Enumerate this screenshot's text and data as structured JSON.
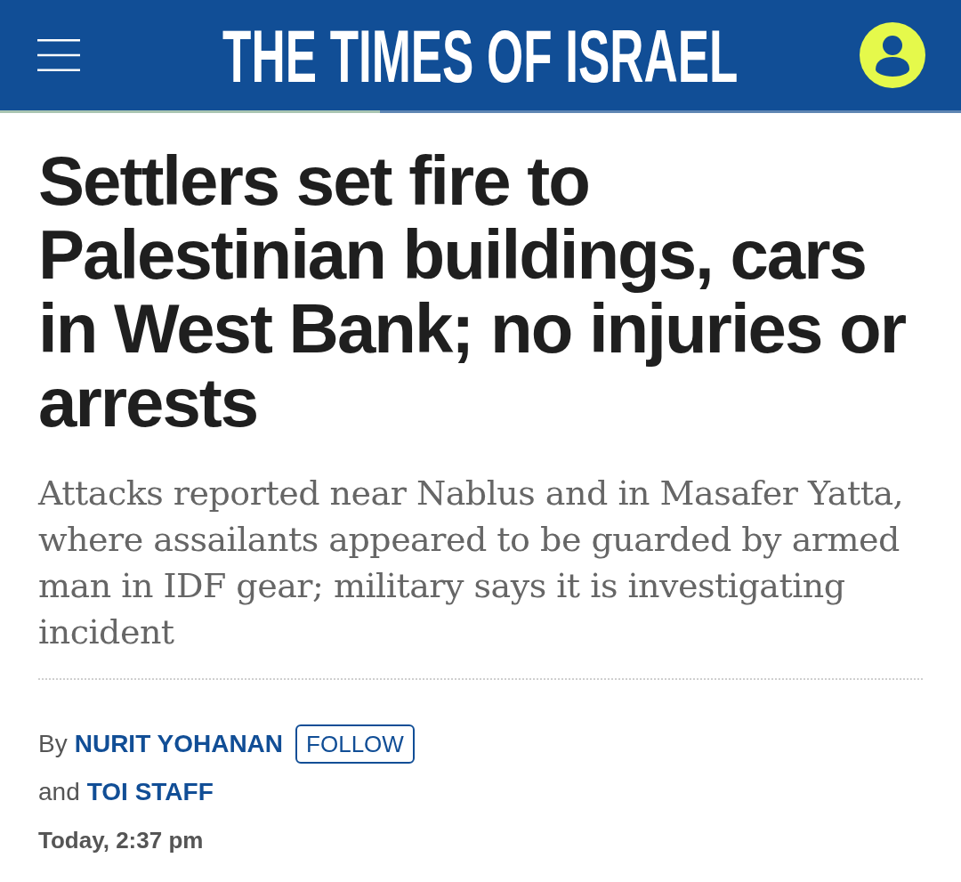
{
  "header": {
    "logo": "THE TIMES OF ISRAEL"
  },
  "reading_progress": {
    "level": 0.395
  },
  "article": {
    "headline": "Settlers set fire to Palestinian buildings, cars in West Bank; no injuries or arrests",
    "subheadline": "Attacks reported near Nablus and in Masafer Yatta, where assailants appeared to be guarded by armed man in IDF gear; military says it is investigating incident",
    "byline": [
      {
        "prefix": "By",
        "author": "NURIT YOHANAN",
        "follow": "FOLLOW"
      },
      {
        "prefix": "and",
        "author": "TOI STAFF"
      }
    ],
    "timestamp": "Today, 2:37 pm"
  }
}
